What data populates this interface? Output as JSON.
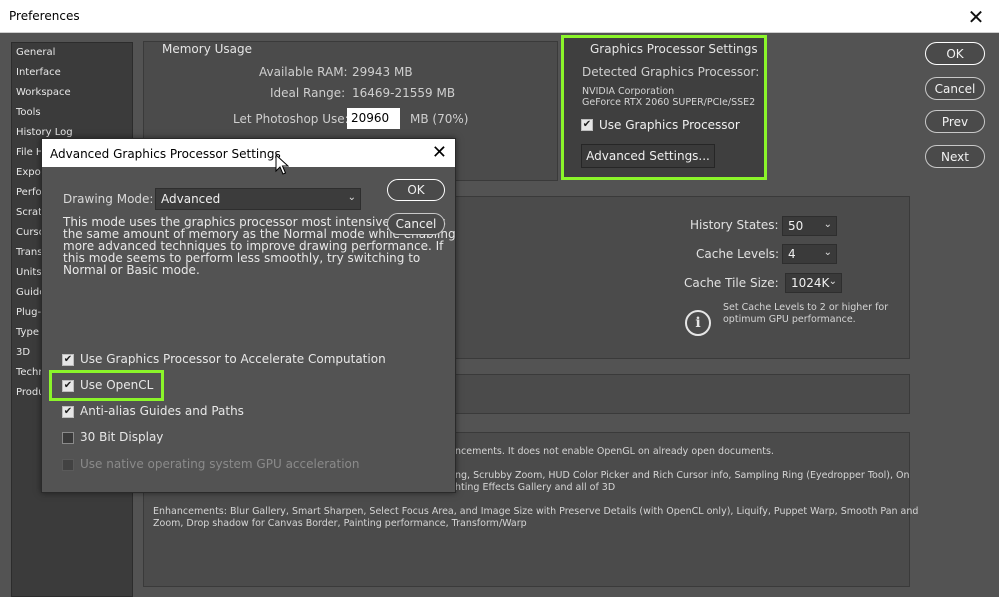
{
  "window": {
    "title": "Preferences",
    "close_glyph": "✕"
  },
  "sidebar": {
    "items": [
      "General",
      "Interface",
      "Workspace",
      "Tools",
      "History Log",
      "File Ha",
      "Expor",
      "Perfo",
      "Scratc",
      "Cursc",
      "Trans",
      "Units",
      "Guide",
      "Plug-i",
      "Type",
      "3D",
      "Techr",
      "Produ"
    ]
  },
  "buttons": {
    "ok": "OK",
    "cancel": "Cancel",
    "prev": "Prev",
    "next": "Next"
  },
  "memory": {
    "title": "Memory Usage",
    "available_label": "Available RAM:",
    "available_value": "29943 MB",
    "ideal_label": "Ideal Range:",
    "ideal_value": "16469-21559 MB",
    "let_label": "Let Photoshop Use:",
    "let_value": "20960",
    "let_suffix": "MB (70%)"
  },
  "gpu": {
    "title": "Graphics Processor Settings",
    "detected_label": "Detected Graphics Processor:",
    "vendor": "NVIDIA Corporation",
    "model": "GeForce RTX 2060 SUPER/PCIe/SSE2",
    "use_label": "Use Graphics Processor",
    "advanced_button": "Advanced Settings...",
    "highlight_color": "#8bf52a"
  },
  "history": {
    "states_label": "History States:",
    "states_value": "50",
    "cache_levels_label": "Cache Levels:",
    "cache_levels_value": "4",
    "tile_size_label": "Cache Tile Size:",
    "tile_size_value": "1024K",
    "note_line1": "Set Cache Levels to 2 or higher for",
    "note_line2": "optimum GPU performance."
  },
  "bottom_text": {
    "line1": "ncements. It does not enable OpenGL on already open documents.",
    "line2": "ng, Scrubby Zoom, HUD Color Picker and Rich Cursor info, Sampling Ring (Eyedropper Tool), On",
    "line3": "hting Effects Gallery and all of 3D",
    "line4": "Enhancements: Blur Gallery, Smart Sharpen, Select Focus Area, and Image Size with Preserve Details (with OpenCL only), Liquify, Puppet Warp, Smooth Pan and",
    "line5": "Zoom, Drop shadow for Canvas Border, Painting performance, Transform/Warp"
  },
  "modal": {
    "title": "Advanced Graphics Processor Settings",
    "close_glyph": "✕",
    "drawing_mode_label": "Drawing Mode:",
    "drawing_mode_value": "Advanced",
    "description_lines": [
      "This mode uses the graphics processor most intensively.  It uses",
      "the same amount of memory as the Normal mode while enabling",
      "more advanced techniques to improve drawing performance.  If",
      "this mode seems to perform less smoothly, try switching to",
      "Normal or Basic mode."
    ],
    "ok": "OK",
    "cancel": "Cancel",
    "opt_accelerate": "Use Graphics Processor to Accelerate Computation",
    "opt_opencl": "Use OpenCL",
    "opt_antialias": "Anti-alias Guides and Paths",
    "opt_30bit": "30 Bit Display",
    "opt_native": "Use native operating system GPU acceleration"
  }
}
